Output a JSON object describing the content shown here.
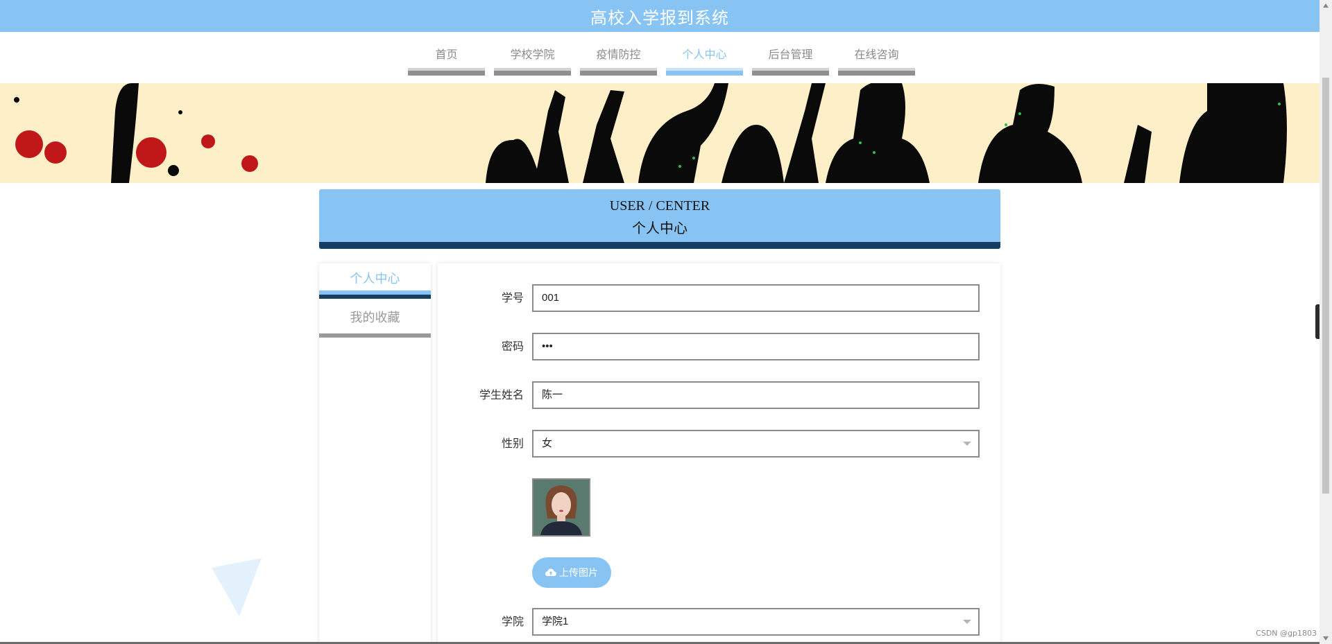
{
  "header": {
    "title": "高校入学报到系统"
  },
  "nav": {
    "items": [
      {
        "label": "首页",
        "active": false
      },
      {
        "label": "学校学院",
        "active": false
      },
      {
        "label": "疫情防控",
        "active": false
      },
      {
        "label": "个人中心",
        "active": true
      },
      {
        "label": "后台管理",
        "active": false
      },
      {
        "label": "在线咨询",
        "active": false
      }
    ]
  },
  "section": {
    "title_en": "USER / CENTER",
    "title_cn": "个人中心"
  },
  "sidebar": {
    "items": [
      {
        "label": "个人中心",
        "active": true
      },
      {
        "label": "我的收藏",
        "active": false
      }
    ]
  },
  "form": {
    "student_id": {
      "label": "学号",
      "value": "001"
    },
    "password": {
      "label": "密码",
      "value": "•••"
    },
    "student_name": {
      "label": "学生姓名",
      "value": "陈一"
    },
    "gender": {
      "label": "性别",
      "value": "女"
    },
    "upload_label": "上传图片",
    "college": {
      "label": "学院",
      "value": "学院1"
    }
  },
  "watermark": "CSDN @gp1803",
  "colors": {
    "accent": "#87c4f4",
    "dark": "#163e62",
    "banner": "#fdefc8"
  },
  "icons": {
    "upload": "cloud-upload-icon",
    "toggle": "chevron-left-icon"
  }
}
